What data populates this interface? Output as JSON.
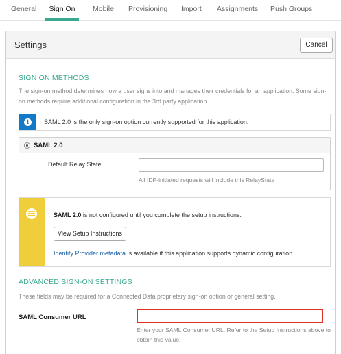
{
  "tabs": [
    {
      "label": "General"
    },
    {
      "label": "Sign On",
      "active": true
    },
    {
      "label": "Mobile"
    },
    {
      "label": "Provisioning"
    },
    {
      "label": "Import"
    },
    {
      "label": "Assignments"
    },
    {
      "label": "Push Groups"
    }
  ],
  "settings": {
    "title": "Settings",
    "cancel_label": "Cancel"
  },
  "sign_on_methods": {
    "title": "SIGN ON METHODS",
    "description": "The sign-on method determines how a user signs into and manages their credentials for an application. Some sign-on methods require additional configuration in the 3rd party application.",
    "info_text": "SAML 2.0 is the only sign-on option currently supported for this application.",
    "option_label": "SAML 2.0",
    "option_selected": true,
    "relay_state_label": "Default Relay State",
    "relay_state_value": "",
    "relay_state_hint": "All IDP-initiated requests will include this RelayState"
  },
  "setup_notice": {
    "bold_part": "SAML 2.0",
    "rest_text": " is not configured until you complete the setup instructions.",
    "button_label": "View Setup Instructions",
    "link_text": "Identity Provider metadata",
    "link_suffix": " is available if this application supports dynamic configuration."
  },
  "advanced": {
    "title": "ADVANCED SIGN-ON SETTINGS",
    "description": "These fields may be required for a Connected Data proprietary sign-on option or general setting.",
    "consumer_url_label": "SAML Consumer URL",
    "consumer_url_value": "",
    "consumer_url_hint": "Enter your SAML Consumer URL. Refer to the Setup Instructions above to obtain this value."
  },
  "colors": {
    "accent": "#3aa88f",
    "info": "#1479c7",
    "warning": "#f0cd3a",
    "highlight": "#e03020",
    "link": "#1b63a8"
  },
  "icons": {
    "info": "info-icon",
    "warning": "list-icon"
  }
}
